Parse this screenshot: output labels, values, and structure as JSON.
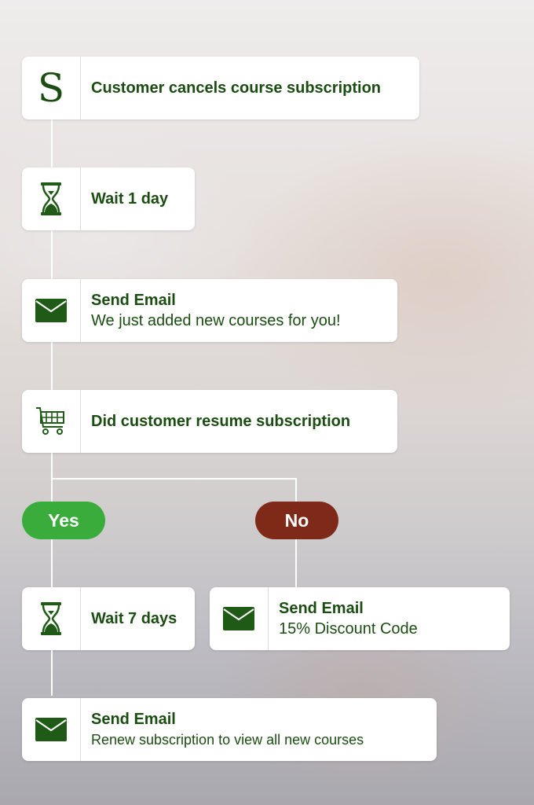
{
  "colors": {
    "text_green": "#1b4d12",
    "icon_green": "#1f5a17",
    "yes_green": "#3aac3c",
    "no_red": "#7f2a18",
    "connector": "#ffffff"
  },
  "nodes": {
    "trigger": {
      "icon": "brand-s-icon",
      "icon_glyph": "S",
      "label": "Customer cancels course subscription"
    },
    "wait1": {
      "icon": "hourglass-icon",
      "label": "Wait 1 day"
    },
    "email1": {
      "icon": "envelope-icon",
      "title": "Send Email",
      "subtitle": "We just added new courses for you!"
    },
    "condition": {
      "icon": "shopping-cart-icon",
      "label": "Did customer resume subscription"
    },
    "branch_yes": {
      "label": "Yes"
    },
    "branch_no": {
      "label": "No"
    },
    "wait7": {
      "icon": "hourglass-icon",
      "label": "Wait 7 days"
    },
    "email_discount": {
      "icon": "envelope-icon",
      "title": "Send Email",
      "subtitle": "15% Discount Code"
    },
    "email_renew": {
      "icon": "envelope-icon",
      "title": "Send Email",
      "subtitle": "Renew subscription to view all new courses"
    }
  }
}
